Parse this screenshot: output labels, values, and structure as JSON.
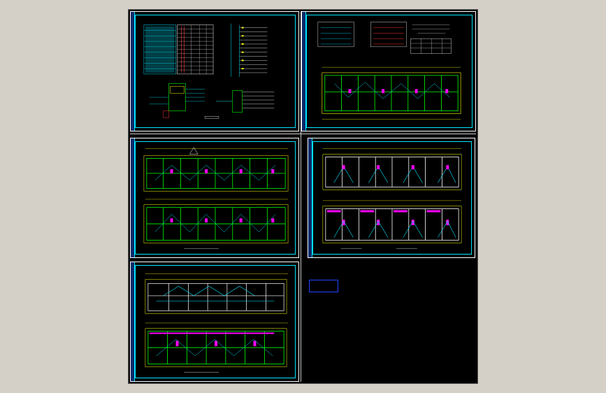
{
  "viewer": {
    "background": "#d4d0c8",
    "canvas_color": "#000000",
    "sheet_frame_color": "#ffffff",
    "inner_frame_color": "#00e5ff"
  },
  "colors": {
    "wall": "#00ff00",
    "wire": "#00e5ff",
    "accent": "#ff00ff",
    "dim": "#ffff00",
    "red": "#ff3030",
    "white": "#ffffff"
  },
  "sheets": [
    {
      "id": "system-diagram-sheet",
      "kind": "system"
    },
    {
      "id": "standard-floor-sheet",
      "kind": "plan-single"
    },
    {
      "id": "floor-plans-sheet-a",
      "kind": "plan-double"
    },
    {
      "id": "floor-plans-sheet-b",
      "kind": "plan-double"
    },
    {
      "id": "floor-plans-sheet-c",
      "kind": "plan-double"
    }
  ],
  "note": {
    "lines": [
      "",
      "",
      ""
    ]
  }
}
